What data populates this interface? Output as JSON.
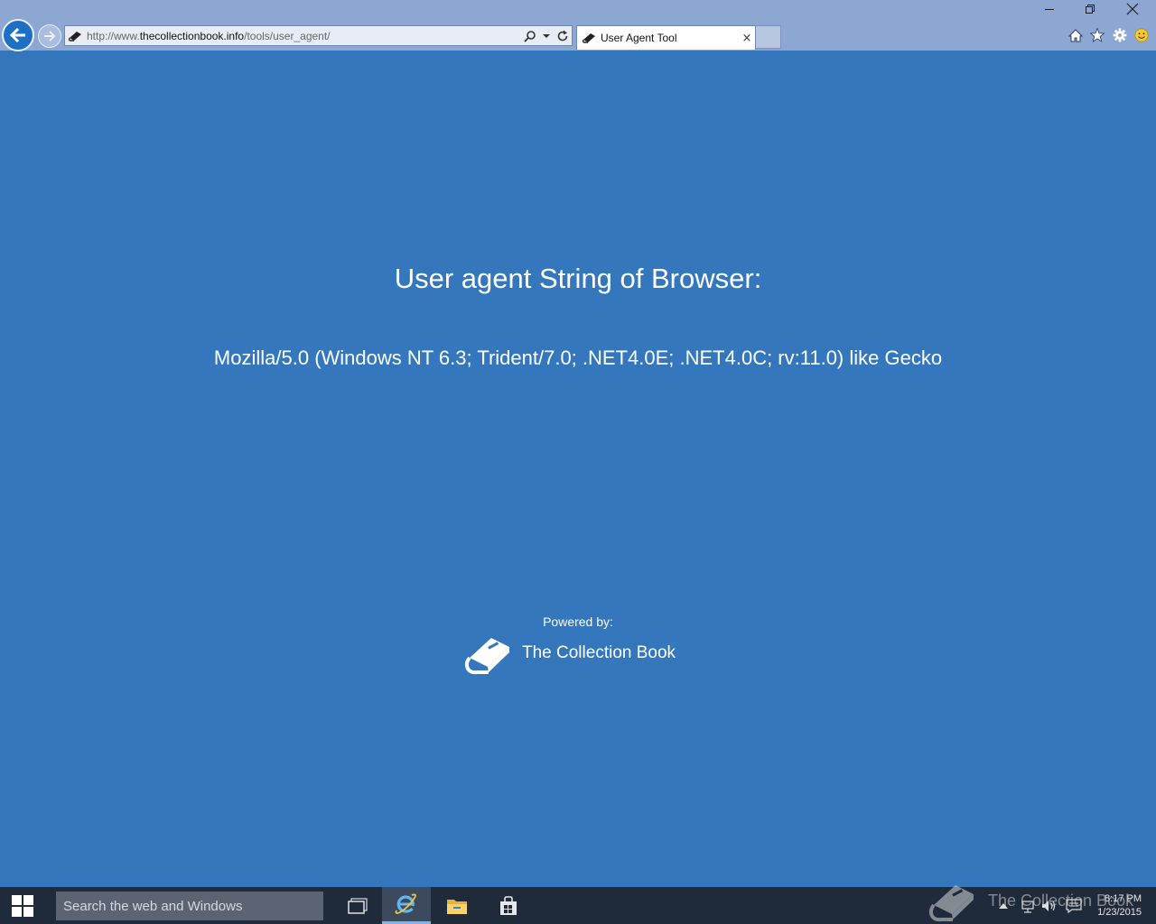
{
  "browser": {
    "address": {
      "prefix": "http://www.",
      "domain": "thecollectionbook.info",
      "path": "/tools/user_agent/"
    },
    "tab": {
      "title": "User Agent Tool",
      "close_glyph": "×"
    },
    "window_controls": [
      "minimize",
      "restore",
      "close"
    ],
    "command_icons": [
      "home-icon",
      "favorites-star-icon",
      "settings-gear-icon",
      "feedback-smiley-icon"
    ]
  },
  "page": {
    "heading": "User agent String of Browser:",
    "user_agent": "Mozilla/5.0 (Windows NT 6.3; Trident/7.0; .NET4.0E; .NET4.0C; rv:11.0) like Gecko",
    "powered_by": "Powered by:",
    "brand_name": "The Collection Book",
    "background_color": "#3477bd"
  },
  "taskbar": {
    "search_placeholder": "Search the web and Windows",
    "apps": [
      "task-view",
      "internet-explorer",
      "file-explorer",
      "store"
    ],
    "watermark_text": "The Collection Book",
    "clock": {
      "time": "8:17 PM",
      "date": "1/23/2015"
    }
  }
}
